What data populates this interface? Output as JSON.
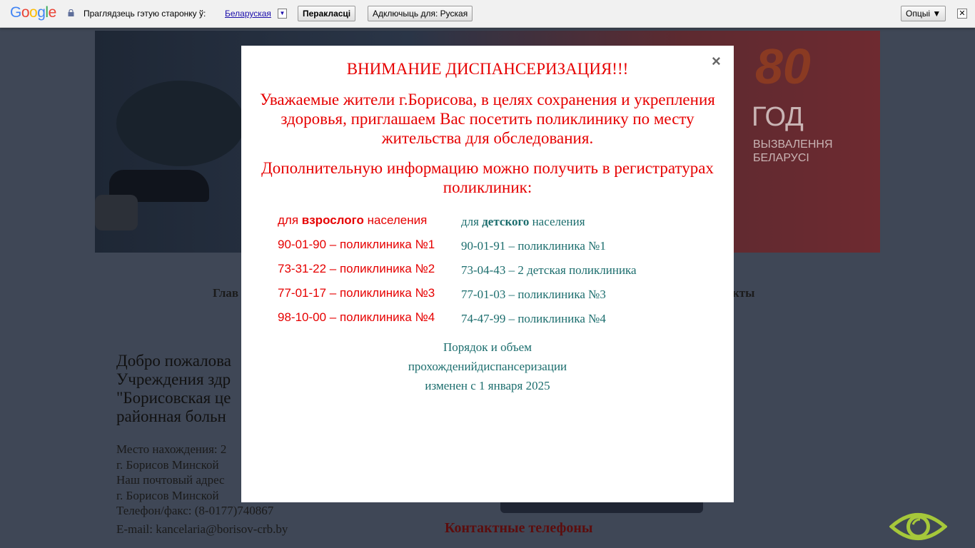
{
  "translate_bar": {
    "logo": "Google",
    "question": "Праглядзець гэтую старонку ў:",
    "language": "Беларуская",
    "translate_button": "Перакласці",
    "disable_button": "Адключыць для: Руская",
    "options_button": "Опцыі ▼",
    "close": "✕"
  },
  "background_page": {
    "banner": {
      "big_number": "80",
      "line1": "ГОД",
      "line2": "ВЫЗВАЛЕННЯ",
      "line3": "БЕЛАРУСІ"
    },
    "nav_left": "Глав",
    "nav_right": "кты",
    "welcome": [
      "Добро пожалова",
      "Учреждения здр",
      "\"Борисовская це",
      "районная больн"
    ],
    "info": [
      "Место нахождения: 2",
      "г. Борисов Минской",
      "Наш почтовый адрес",
      "г. Борисов Минской",
      "Телефон/факс: (8-0177)740867"
    ],
    "email": "E-mail: kancelaria@borisov-crb.by",
    "contacts_heading": "Контактные телефоны"
  },
  "modal": {
    "close": "×",
    "title": "ВНИМАНИЕ ДИСПАНСЕРИЗАЦИЯ!!!",
    "paragraph1": "Уважаемые жители г.Борисова, в целях сохранения и укрепления здоровья, приглашаем Вас посетить поликлинику по месту жительства для обследования.",
    "paragraph2": "Дополнительную информацию можно получить в регистратурах поликлиник:",
    "adult": {
      "prefix": "для ",
      "bold": "взрослого",
      "suffix": " населения",
      "rows": [
        "90-01-90 – поликлиника №1",
        "73-31-22 – поликлиника №2",
        "77-01-17 – поликлиника №3",
        "98-10-00 – поликлиника №4"
      ]
    },
    "child": {
      "prefix": "для ",
      "bold": "детского",
      "suffix": " населения",
      "rows": [
        "90-01-91 – поликлиника №1",
        "73-04-43 – 2 детская поликлиника",
        "77-01-03 – поликлиника №3",
        "74-47-99 – поликлиника №4"
      ]
    },
    "footer": [
      "Порядок и объем",
      "прохожденийдиспансеризации",
      "изменен с 1 января 2025"
    ]
  },
  "colors": {
    "alert_red": "#e60000",
    "teal": "#1b6d6d",
    "accent_eye": "#a6c83a"
  }
}
